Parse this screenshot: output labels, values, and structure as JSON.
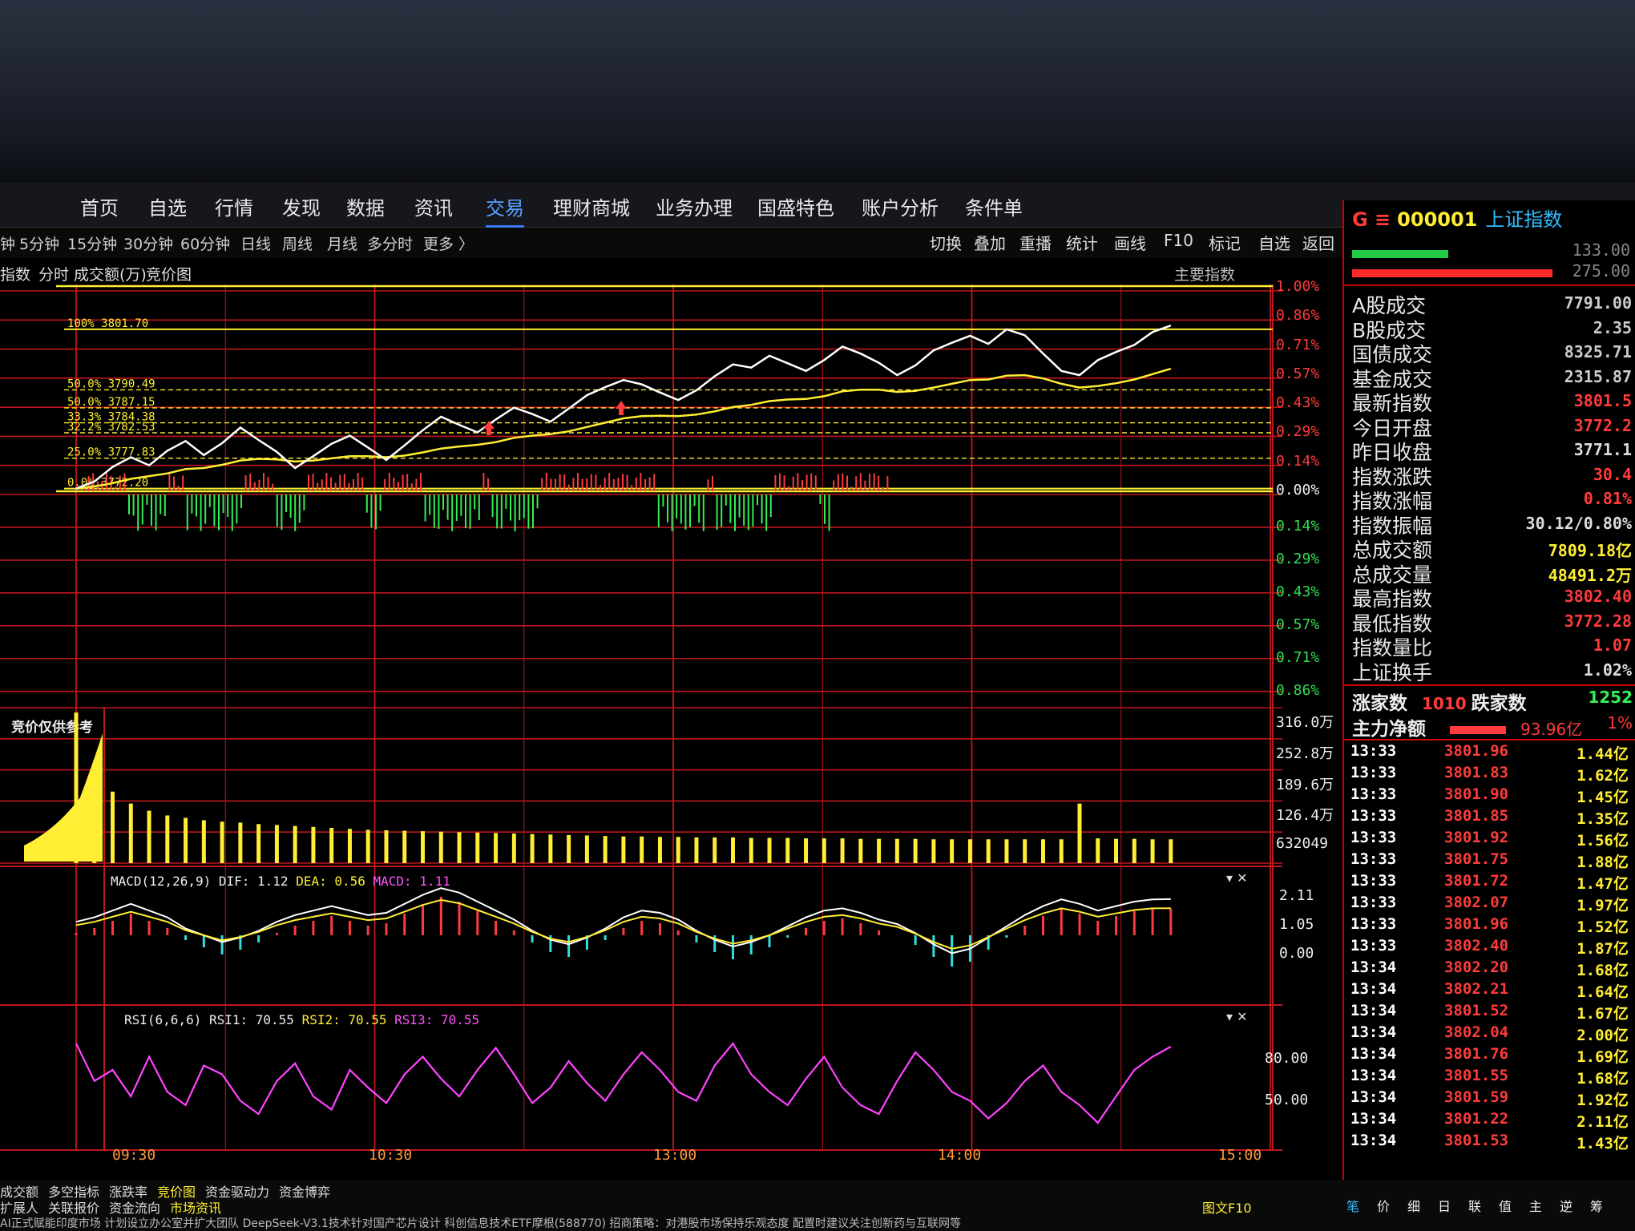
{
  "nav": {
    "items": [
      "首页",
      "自选",
      "行情",
      "发现",
      "数据",
      "资讯",
      "交易",
      "理财商城",
      "业务办理",
      "国盛特色",
      "账户分析",
      "条件单"
    ],
    "active_index": 6
  },
  "toolbar": {
    "periods": [
      "钟",
      "5分钟",
      "15分钟",
      "30分钟",
      "60分钟",
      "日线",
      "周线",
      "月线",
      "多分时",
      "更多 〉"
    ],
    "buttons": [
      "切换",
      "叠加",
      "重播",
      "统计",
      "画线",
      "F10",
      "标记",
      "自选",
      "返回"
    ]
  },
  "subbar": {
    "items": [
      "指数",
      "分时",
      "成交额(万)",
      "竞价图"
    ],
    "main_index": "主要指数"
  },
  "symbol": {
    "code": "000001",
    "name": "上证指数",
    "prefix": "G ≡"
  },
  "price_axis": {
    "pos_labels": [
      "1.00%",
      "0.86%",
      "0.71%",
      "0.57%",
      "0.43%",
      "0.29%",
      "0.14%",
      "0.00%"
    ],
    "neg_labels": [
      "0.14%",
      "0.29%",
      "0.43%",
      "0.57%",
      "0.71%",
      "0.86%"
    ]
  },
  "volume_axis": {
    "labels": [
      "316.0万",
      "252.8万",
      "189.6万",
      "126.4万",
      "632049"
    ]
  },
  "macd_axis": {
    "labels": [
      "2.11",
      "1.05",
      "0.00"
    ]
  },
  "rsi_axis": {
    "labels": [
      "80.00",
      "50.00"
    ]
  },
  "fib_labels": [
    "100% 3801.70",
    "50.0% 3790.49",
    "50.0% 3787.15",
    "33.3% 3784.38",
    "32.2% 3782.53",
    "25.0% 3777.83",
    "0.0% 3772.20"
  ],
  "auction_label": "竞价仅供参考",
  "macd": {
    "title": "MACD(12,26,9)",
    "dif": "DIF: 1.12",
    "dea": "DEA: 0.56",
    "macd": "MACD: 1.11"
  },
  "rsi": {
    "title": "RSI(6,6,6)",
    "rsi1": "RSI1: 70.55",
    "rsi2": "RSI2: 70.55",
    "rsi3": "RSI3: 70.55"
  },
  "time_axis": [
    "09:30",
    "10:30",
    "13:00",
    "14:00",
    "15:00"
  ],
  "bottom_tabs": [
    "成交额",
    "多空指标",
    "涨跌率",
    "竞价图",
    "资金驱动力",
    "资金博弈"
  ],
  "bottom_tabs2": [
    "扩展人",
    "关联报价",
    "资金流向",
    "市场资讯"
  ],
  "bottom_right_tabs": [
    "笔",
    "价",
    "细",
    "日",
    "联",
    "值",
    "主",
    "逆",
    "筹"
  ],
  "ticker": "AI正式赋能印度市场 计划设立办公室并扩大团队    DeepSeek-V3.1技术针对国产芯片设计 科创信息技术ETF摩根(588770)    招商策略：对港股市场保持乐观态度 配置时建议关注创新药与互联网等",
  "f10_label": "图文F10",
  "panel_top_values": [
    "133.00",
    "275.00"
  ],
  "stats": [
    {
      "label": "A股成交",
      "value": "7791.00",
      "color": "#cccccc"
    },
    {
      "label": "B股成交",
      "value": "2.35",
      "color": "#cccccc"
    },
    {
      "label": "国债成交",
      "value": "8325.71",
      "color": "#cccccc"
    },
    {
      "label": "基金成交",
      "value": "2315.87",
      "color": "#cccccc"
    },
    {
      "label": "最新指数",
      "value": "3801.5",
      "color": "#ff3b3b"
    },
    {
      "label": "今日开盘",
      "value": "3772.2",
      "color": "#ff3b3b"
    },
    {
      "label": "昨日收盘",
      "value": "3771.1",
      "color": "#dddddd"
    },
    {
      "label": "指数涨跌",
      "value": "30.4",
      "color": "#ff3b3b"
    },
    {
      "label": "指数涨幅",
      "value": "0.81%",
      "color": "#ff3b3b"
    },
    {
      "label": "指数振幅",
      "value": "30.12/0.80%",
      "color": "#dddddd"
    },
    {
      "label": "总成交额",
      "value": "7809.18亿",
      "color": "#ffee33"
    },
    {
      "label": "总成交量",
      "value": "48491.2万",
      "color": "#ffee33"
    },
    {
      "label": "最高指数",
      "value": "3802.40",
      "color": "#ff3b3b"
    },
    {
      "label": "最低指数",
      "value": "3772.28",
      "color": "#ff3b3b"
    },
    {
      "label": "指数量比",
      "value": "1.07",
      "color": "#ff3b3b"
    },
    {
      "label": "上证换手",
      "value": "1.02%",
      "color": "#dddddd"
    }
  ],
  "breadth": {
    "up_label": "涨家数",
    "up": "1010",
    "down_label": "跌家数",
    "down": "1252"
  },
  "main_flow": {
    "label": "主力净额",
    "value": "93.96亿",
    "pct": "1%"
  },
  "ticks": [
    {
      "time": "13:33",
      "price": "3801.96",
      "amt": "1.44亿"
    },
    {
      "time": "13:33",
      "price": "3801.83",
      "amt": "1.62亿"
    },
    {
      "time": "13:33",
      "price": "3801.90",
      "amt": "1.45亿"
    },
    {
      "time": "13:33",
      "price": "3801.85",
      "amt": "1.35亿"
    },
    {
      "time": "13:33",
      "price": "3801.92",
      "amt": "1.56亿"
    },
    {
      "time": "13:33",
      "price": "3801.75",
      "amt": "1.88亿"
    },
    {
      "time": "13:33",
      "price": "3801.72",
      "amt": "1.47亿"
    },
    {
      "time": "13:33",
      "price": "3802.07",
      "amt": "1.97亿"
    },
    {
      "time": "13:33",
      "price": "3801.96",
      "amt": "1.52亿"
    },
    {
      "time": "13:33",
      "price": "3802.40",
      "amt": "1.87亿"
    },
    {
      "time": "13:34",
      "price": "3802.20",
      "amt": "1.68亿"
    },
    {
      "time": "13:34",
      "price": "3802.21",
      "amt": "1.64亿"
    },
    {
      "time": "13:34",
      "price": "3801.52",
      "amt": "1.67亿"
    },
    {
      "time": "13:34",
      "price": "3802.04",
      "amt": "2.00亿"
    },
    {
      "time": "13:34",
      "price": "3801.76",
      "amt": "1.69亿"
    },
    {
      "time": "13:34",
      "price": "3801.55",
      "amt": "1.68亿"
    },
    {
      "time": "13:34",
      "price": "3801.59",
      "amt": "1.92亿"
    },
    {
      "time": "13:34",
      "price": "3801.22",
      "amt": "2.11亿"
    },
    {
      "time": "13:34",
      "price": "3801.53",
      "amt": "1.43亿"
    }
  ],
  "chart_data": {
    "type": "line",
    "prev_close": 3771.1,
    "ylim": [
      3733.39,
      3808.81
    ],
    "minutes_shown": 220,
    "price_series": [
      3772.2,
      3773.5,
      3776.2,
      3778.0,
      3776.5,
      3779.2,
      3781.0,
      3778.4,
      3780.6,
      3783.5,
      3781.2,
      3779.0,
      3776.0,
      3778.2,
      3780.5,
      3782.0,
      3779.8,
      3777.5,
      3780.2,
      3783.0,
      3785.5,
      3784.0,
      3782.6,
      3785.0,
      3787.2,
      3786.0,
      3784.6,
      3787.0,
      3789.5,
      3791.0,
      3792.3,
      3791.5,
      3790.0,
      3788.6,
      3790.4,
      3793.0,
      3795.2,
      3794.6,
      3796.8,
      3795.4,
      3794.0,
      3796.0,
      3798.5,
      3797.2,
      3795.5,
      3793.2,
      3795.0,
      3797.8,
      3799.2,
      3800.5,
      3799.0,
      3801.7,
      3800.6,
      3797.2,
      3794.0,
      3793.2,
      3796.0,
      3797.5,
      3798.8,
      3801.2,
      3802.4
    ],
    "avg_series": [
      3772.2,
      3772.6,
      3773.2,
      3774.0,
      3774.5,
      3775.0,
      3775.8,
      3776.0,
      3776.6,
      3777.4,
      3777.7,
      3777.6,
      3777.2,
      3777.4,
      3777.8,
      3778.2,
      3778.2,
      3778.0,
      3778.3,
      3778.9,
      3779.6,
      3780.0,
      3780.3,
      3780.8,
      3781.6,
      3782.0,
      3782.3,
      3782.8,
      3783.6,
      3784.4,
      3785.2,
      3785.6,
      3785.7,
      3785.6,
      3785.9,
      3786.5,
      3787.3,
      3787.7,
      3788.4,
      3788.7,
      3788.8,
      3789.3,
      3790.2,
      3790.5,
      3790.5,
      3790.1,
      3790.3,
      3790.9,
      3791.6,
      3792.3,
      3792.4,
      3793.1,
      3793.2,
      3792.6,
      3791.6,
      3790.9,
      3791.2,
      3791.7,
      3792.4,
      3793.4,
      3794.4
    ],
    "fib_levels": [
      3801.7,
      3790.49,
      3787.15,
      3784.38,
      3782.53,
      3777.83,
      3772.2
    ],
    "volume_series": [
      3160000,
      2100000,
      1500000,
      1250000,
      1100000,
      1000000,
      950000,
      900000,
      870000,
      850000,
      820000,
      800000,
      780000,
      760000,
      740000,
      720000,
      700000,
      690000,
      680000,
      670000,
      660000,
      650000,
      640000,
      630000,
      620000,
      610000,
      600000,
      590000,
      580000,
      570000,
      560000,
      560000,
      550000,
      550000,
      540000,
      540000,
      540000,
      530000,
      530000,
      530000,
      520000,
      520000,
      520000,
      510000,
      510000,
      510000,
      510000,
      500000,
      500000,
      500000,
      500000,
      500000,
      500000,
      500000,
      500000,
      1250000,
      520000,
      510000,
      510000,
      500000,
      500000
    ],
    "macd_series": [
      0.1,
      0.3,
      0.6,
      0.9,
      0.6,
      0.3,
      -0.2,
      -0.5,
      -0.8,
      -0.6,
      -0.3,
      0.1,
      0.4,
      0.6,
      0.8,
      0.6,
      0.4,
      0.5,
      0.9,
      1.3,
      1.6,
      1.4,
      1.0,
      0.6,
      0.2,
      -0.3,
      -0.7,
      -0.9,
      -0.6,
      -0.2,
      0.3,
      0.6,
      0.5,
      0.2,
      -0.3,
      -0.7,
      -1.0,
      -0.8,
      -0.5,
      -0.1,
      0.3,
      0.6,
      0.7,
      0.5,
      0.2,
      0.0,
      -0.4,
      -0.9,
      -1.3,
      -1.1,
      -0.6,
      -0.1,
      0.4,
      0.8,
      1.1,
      0.9,
      0.6,
      0.8,
      1.0,
      1.1,
      1.11
    ],
    "rsi_series": [
      72,
      55,
      60,
      48,
      66,
      50,
      44,
      62,
      58,
      46,
      40,
      55,
      63,
      48,
      42,
      60,
      52,
      45,
      58,
      66,
      56,
      48,
      60,
      70,
      58,
      45,
      52,
      64,
      54,
      46,
      58,
      68,
      60,
      50,
      46,
      62,
      72,
      58,
      50,
      44,
      56,
      66,
      52,
      44,
      40,
      55,
      68,
      60,
      50,
      46,
      38,
      45,
      55,
      62,
      50,
      44,
      36,
      48,
      60,
      66,
      70.55
    ]
  }
}
